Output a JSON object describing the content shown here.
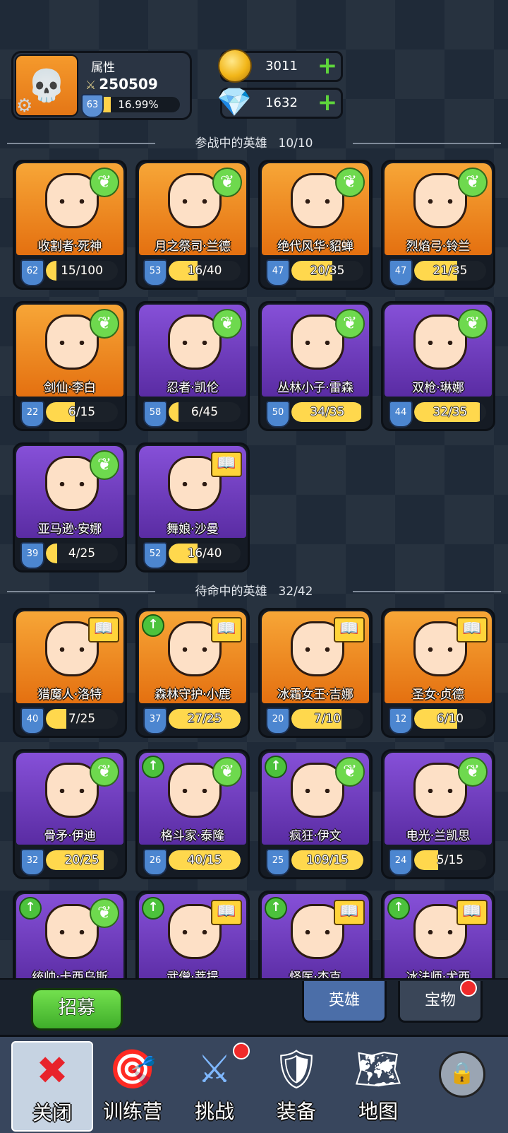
{
  "player": {
    "attr_label": "属性",
    "power": "250509",
    "level": "63",
    "xp_percent_text": "16.99%",
    "xp_fraction": 0.1699
  },
  "currency": {
    "gold": "3011",
    "gems": "1632"
  },
  "deployed": {
    "title": "参战中的英雄",
    "count": "10/10",
    "heroes": [
      {
        "name": "收割者·死神",
        "level": "62",
        "progress": "15/100",
        "ratio": 0.15,
        "color": "orange",
        "badge": "wing"
      },
      {
        "name": "月之祭司·兰德",
        "level": "53",
        "progress": "16/40",
        "ratio": 0.4,
        "color": "orange",
        "badge": "wing"
      },
      {
        "name": "绝代风华·貂蝉",
        "level": "47",
        "progress": "20/35",
        "ratio": 0.571,
        "color": "orange",
        "badge": "wing"
      },
      {
        "name": "烈焰弓·铃兰",
        "level": "47",
        "progress": "21/35",
        "ratio": 0.6,
        "color": "orange",
        "badge": "wing"
      },
      {
        "name": "剑仙·李白",
        "level": "22",
        "progress": "6/15",
        "ratio": 0.4,
        "color": "orange",
        "badge": "wing"
      },
      {
        "name": "忍者·凯伦",
        "level": "58",
        "progress": "6/45",
        "ratio": 0.133,
        "color": "purple",
        "badge": "wing"
      },
      {
        "name": "丛林小子·雷森",
        "level": "50",
        "progress": "34/35",
        "ratio": 0.971,
        "color": "purple",
        "badge": "wing"
      },
      {
        "name": "双枪·琳娜",
        "level": "44",
        "progress": "32/35",
        "ratio": 0.914,
        "color": "purple",
        "badge": "wing"
      },
      {
        "name": "亚马逊·安娜",
        "level": "39",
        "progress": "4/25",
        "ratio": 0.16,
        "color": "purple",
        "badge": "wing"
      },
      {
        "name": "舞娘·沙曼",
        "level": "52",
        "progress": "16/40",
        "ratio": 0.4,
        "color": "purple",
        "badge": "book"
      }
    ]
  },
  "standby": {
    "title": "待命中的英雄",
    "count": "32/42",
    "heroes": [
      {
        "name": "猎魔人·洛特",
        "level": "40",
        "progress": "7/25",
        "ratio": 0.28,
        "color": "orange",
        "badge": "book",
        "upgrade": false
      },
      {
        "name": "森林守护·小鹿",
        "level": "37",
        "progress": "27/25",
        "ratio": 1,
        "color": "orange",
        "badge": "book",
        "upgrade": true
      },
      {
        "name": "冰霜女王·吉娜",
        "level": "20",
        "progress": "7/10",
        "ratio": 0.7,
        "color": "orange",
        "badge": "book",
        "upgrade": false
      },
      {
        "name": "圣女·贞德",
        "level": "12",
        "progress": "6/10",
        "ratio": 0.6,
        "color": "orange",
        "badge": "book",
        "upgrade": false
      },
      {
        "name": "骨矛·伊迪",
        "level": "32",
        "progress": "20/25",
        "ratio": 0.8,
        "color": "purple",
        "badge": "wing",
        "upgrade": false
      },
      {
        "name": "格斗家·泰隆",
        "level": "26",
        "progress": "40/15",
        "ratio": 1,
        "color": "purple",
        "badge": "wing",
        "upgrade": true
      },
      {
        "name": "疯狂·伊文",
        "level": "25",
        "progress": "109/15",
        "ratio": 1,
        "color": "purple",
        "badge": "wing",
        "upgrade": true
      },
      {
        "name": "电光·兰凯思",
        "level": "24",
        "progress": "5/15",
        "ratio": 0.333,
        "color": "purple",
        "badge": "wing",
        "upgrade": false
      },
      {
        "name": "统帅·卡西乌斯",
        "level": "",
        "progress": "",
        "ratio": 0,
        "color": "purple",
        "badge": "wing",
        "upgrade": true
      },
      {
        "name": "武僧·菩提",
        "level": "",
        "progress": "",
        "ratio": 0,
        "color": "purple",
        "badge": "book",
        "upgrade": true
      },
      {
        "name": "怪医·杰克",
        "level": "",
        "progress": "",
        "ratio": 0,
        "color": "purple",
        "badge": "book",
        "upgrade": true
      },
      {
        "name": "冰法师·尤西",
        "level": "",
        "progress": "",
        "ratio": 0,
        "color": "purple",
        "badge": "book",
        "upgrade": true
      }
    ]
  },
  "actions": {
    "recruit": "招募",
    "tab_heroes": "英雄",
    "tab_treasure": "宝物"
  },
  "nav": [
    {
      "label": "关闭",
      "icon": "close-icon",
      "glyph": "✖"
    },
    {
      "label": "训练营",
      "icon": "training-target-icon",
      "glyph": "🎯"
    },
    {
      "label": "挑战",
      "icon": "sword-icon",
      "glyph": "⚔"
    },
    {
      "label": "装备",
      "icon": "armor-icon",
      "glyph": "🛡"
    },
    {
      "label": "地图",
      "icon": "map-icon",
      "glyph": "🗺"
    },
    {
      "label": "",
      "icon": "lock-icon",
      "glyph": "🔒"
    }
  ],
  "colors": {
    "orange_card": "#f08a22",
    "purple_card": "#6d3cc0",
    "progress_fill": "#ffd84d",
    "accent_green": "#5ed43c"
  }
}
